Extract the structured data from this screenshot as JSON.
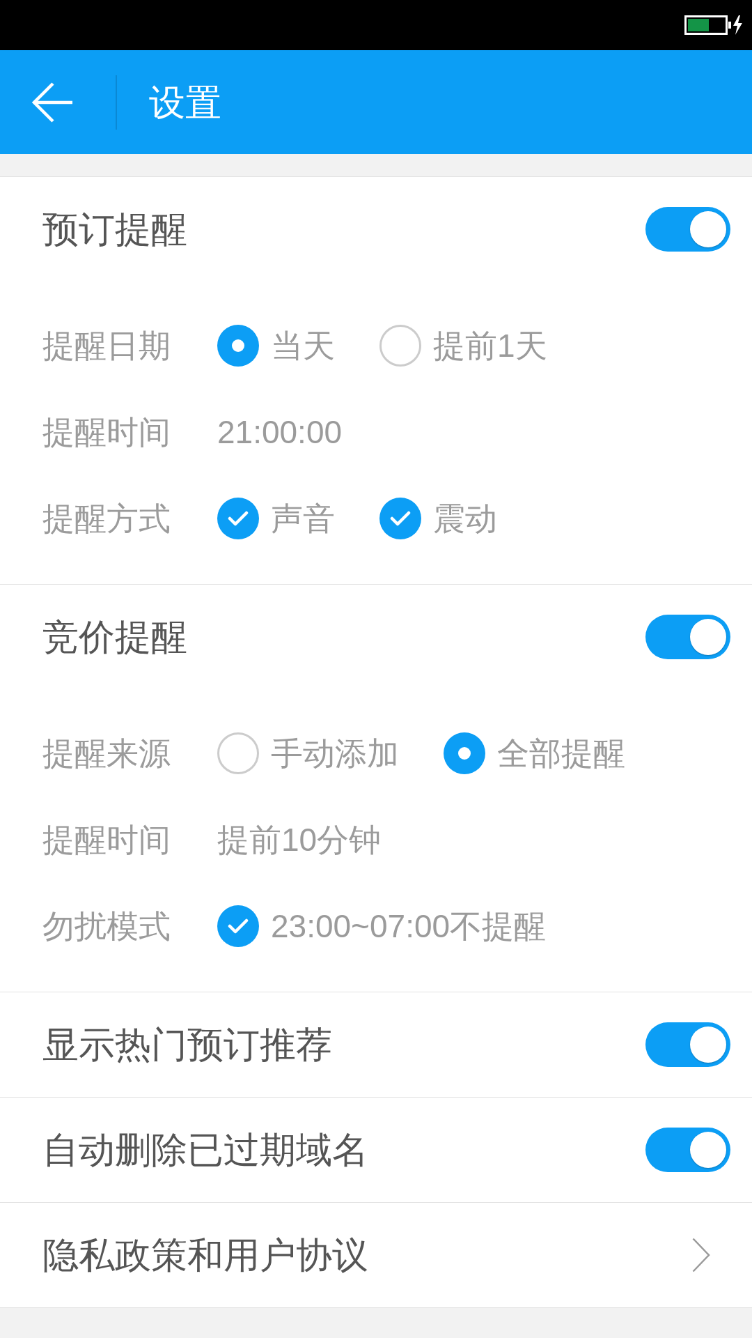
{
  "header": {
    "title": "设置"
  },
  "sections": [
    {
      "kind": "group",
      "title": "预订提醒",
      "on": true,
      "rows": [
        {
          "kind": "radio",
          "label": "提醒日期",
          "options": [
            {
              "label": "当天",
              "selected": true
            },
            {
              "label": "提前1天",
              "selected": false
            }
          ]
        },
        {
          "kind": "text",
          "label": "提醒时间",
          "value": "21:00:00"
        },
        {
          "kind": "checkbox",
          "label": "提醒方式",
          "options": [
            {
              "label": "声音",
              "checked": true
            },
            {
              "label": "震动",
              "checked": true
            }
          ]
        }
      ]
    },
    {
      "kind": "group",
      "title": "竞价提醒",
      "on": true,
      "rows": [
        {
          "kind": "radio",
          "label": "提醒来源",
          "options": [
            {
              "label": "手动添加",
              "selected": false
            },
            {
              "label": "全部提醒",
              "selected": true
            }
          ]
        },
        {
          "kind": "text",
          "label": "提醒时间",
          "value": "提前10分钟"
        },
        {
          "kind": "checkbox",
          "label": "勿扰模式",
          "options": [
            {
              "label": "23:00~07:00不提醒",
              "checked": true
            }
          ]
        }
      ]
    },
    {
      "kind": "toggle",
      "title": "显示热门预订推荐",
      "on": true
    },
    {
      "kind": "toggle",
      "title": "自动删除已过期域名",
      "on": true
    },
    {
      "kind": "link",
      "title": "隐私政策和用户协议"
    }
  ]
}
